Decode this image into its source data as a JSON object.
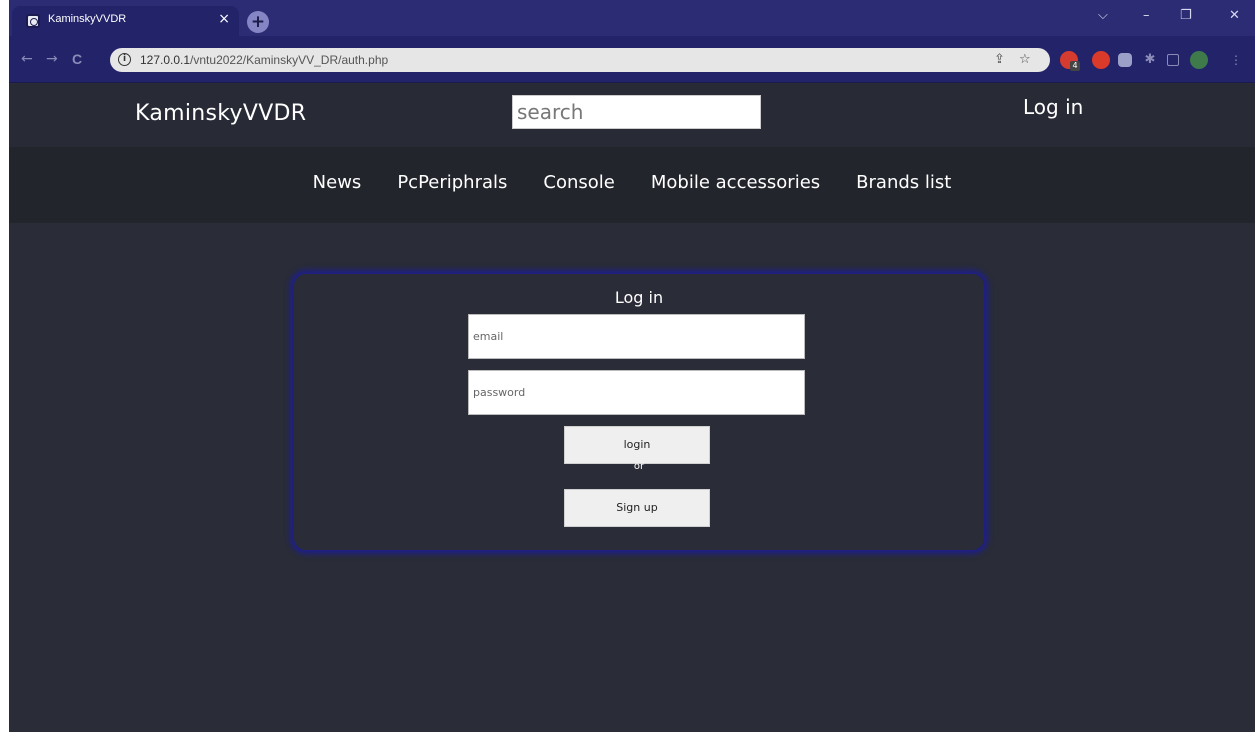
{
  "browser": {
    "tab_title": "KaminskyVVDR",
    "tab_close": "×",
    "new_tab": "+",
    "url_host": "127.0.0.1",
    "url_path": "/vntu2022/KaminskyVV_DR/auth.php",
    "window_controls": {
      "dropdown": "⌵",
      "minimize": "–",
      "restore": "❐",
      "close": "✕"
    },
    "nav": {
      "back": "←",
      "forward": "→",
      "reload": "C"
    },
    "info": "i",
    "share_icon": "⇪",
    "star_icon": "☆",
    "ext_badge": "4",
    "colors": {
      "tabstrip": "#2c2c74",
      "toolbar": "#23236a"
    }
  },
  "site": {
    "brand": "KaminskyVVDR",
    "search_placeholder": "search",
    "header_login": "Log in",
    "nav": [
      "News",
      "PcPeriphrals",
      "Console",
      "Mobile accessories",
      "Brands list"
    ]
  },
  "auth_form": {
    "title": "Log in",
    "email_placeholder": "email",
    "password_placeholder": "password",
    "login_button": "login",
    "or": "or",
    "signup_button": "Sign up"
  }
}
